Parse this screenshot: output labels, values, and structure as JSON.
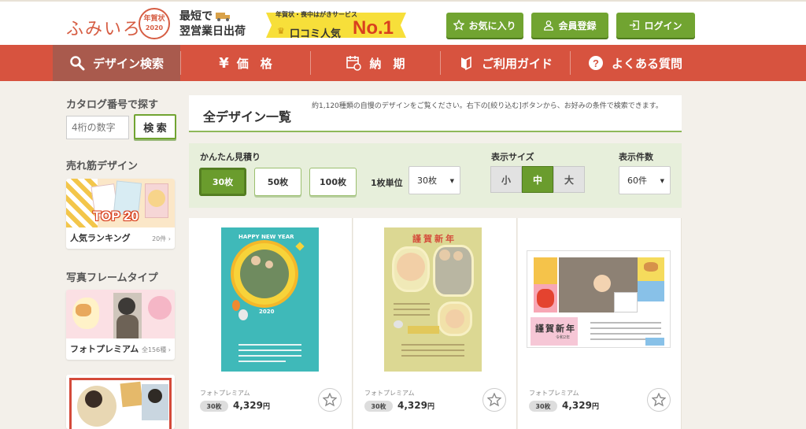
{
  "header": {
    "logo_text": "ふみいろ",
    "logo_stamp_top": "年賀状",
    "logo_stamp_year": "2020",
    "tagline_line1": "最短で",
    "tagline_line2": "翌営業日出荷",
    "badge_sub": "年賀状・喪中はがきサービス",
    "badge_main": "口コミ人気",
    "badge_rank": "No.1",
    "buttons": [
      {
        "label": "お気に入り",
        "icon": "star-icon"
      },
      {
        "label": "会員登録",
        "icon": "user-icon"
      },
      {
        "label": "ログイン",
        "icon": "login-icon"
      }
    ]
  },
  "nav": {
    "items": [
      {
        "label": "デザイン検索",
        "icon": "search-icon"
      },
      {
        "label": "価　格",
        "icon": "yen-icon"
      },
      {
        "label": "納　期",
        "icon": "calendar-icon"
      },
      {
        "label": "ご利用ガイド",
        "icon": "guide-icon"
      },
      {
        "label": "よくある質問",
        "icon": "question-icon"
      }
    ]
  },
  "sidebar": {
    "catalog_heading": "カタログ番号で探す",
    "catalog_placeholder": "4桁の数字",
    "catalog_button": "検 索",
    "bestseller_heading": "売れ筋デザイン",
    "ranking": {
      "label": "人気ランキング",
      "count": "20件",
      "badge": "TOP 20"
    },
    "frame_heading": "写真フレームタイプ",
    "frame": {
      "label": "フォトプレミアム",
      "count": "全156種"
    }
  },
  "main": {
    "title": "全デザイン一覧",
    "description": "約1,120種類の自慢のデザインをご覧ください。右下の[絞り込む]ボタンから、お好みの条件で検索できます。",
    "filter": {
      "estimate_label": "かんたん見積り",
      "quantities": [
        "30枚",
        "50枚",
        "100枚"
      ],
      "unit_label": "1枚単位",
      "unit_value": "30枚",
      "size_label": "表示サイズ",
      "sizes": [
        "小",
        "中",
        "大"
      ],
      "count_label": "表示件数",
      "count_value": "60件"
    },
    "products": [
      {
        "kind": "フォトプレミアム",
        "qty": "30枚",
        "price": "4,329",
        "yen": "円",
        "card_text": "HAPPY NEW YEAR",
        "year": "2020"
      },
      {
        "kind": "フォトプレミアム",
        "qty": "30枚",
        "price": "4,329",
        "yen": "円",
        "card_text": "謹賀新年"
      },
      {
        "kind": "フォトプレミアム",
        "qty": "30枚",
        "price": "4,329",
        "yen": "円",
        "card_text": "謹賀新年",
        "card_sub": "令和2年"
      }
    ]
  },
  "colors": {
    "accent_red": "#d7533f",
    "accent_green": "#71a431",
    "rank_red": "#d9411e"
  }
}
